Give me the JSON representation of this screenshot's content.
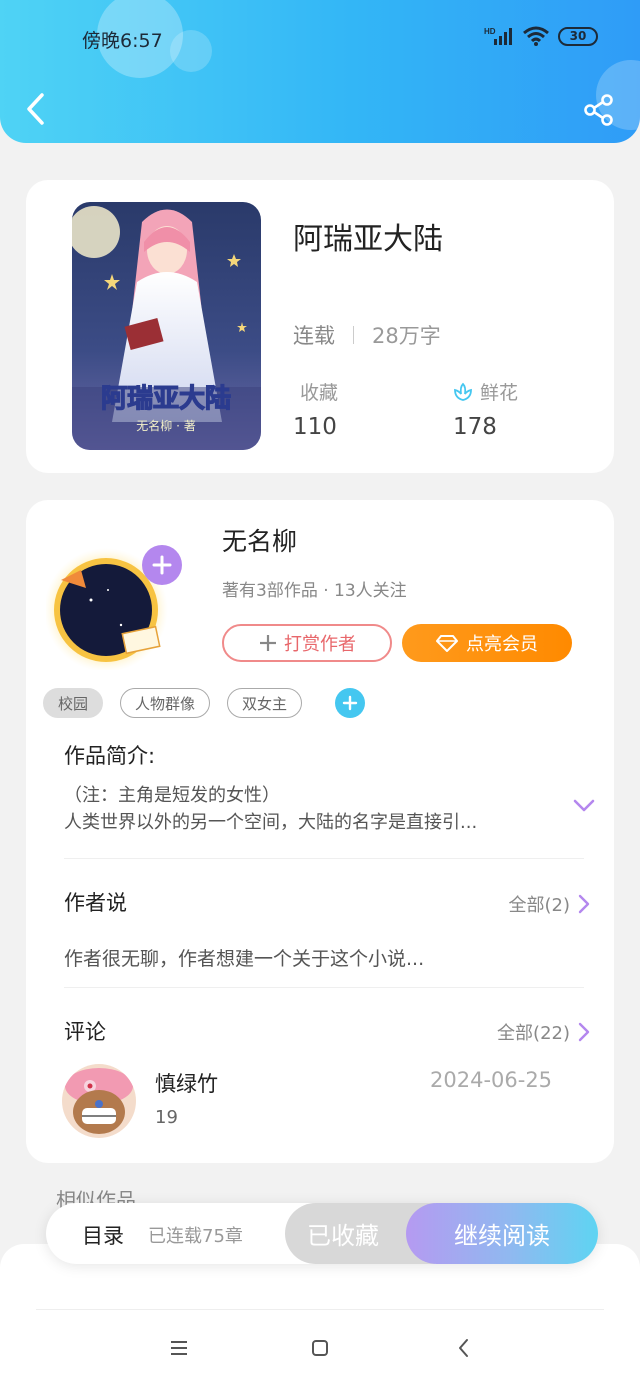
{
  "status_bar": {
    "time": "傍晚6:57",
    "battery": "30"
  },
  "book": {
    "title": "阿瑞亚大陆",
    "status": "连载",
    "word_count": "28万字",
    "favorites_label": "收藏",
    "favorites_value": "110",
    "flowers_label": "鲜花",
    "flowers_value": "178",
    "cover_title": "阿瑞亚大陆",
    "cover_author": "无名柳 · 著"
  },
  "author": {
    "name": "无名柳",
    "meta": "著有3部作品 · 13人关注",
    "tip_label": "打赏作者",
    "vip_label": "点亮会员"
  },
  "tags": [
    "校园",
    "人物群像",
    "双女主"
  ],
  "intro": {
    "title": "作品简介:",
    "line1": "（注：主角是短发的女性）",
    "line2": "人类世界以外的另一个空间，大陆的名字是直接引..."
  },
  "author_says": {
    "title": "作者说",
    "see_all": "全部(2)",
    "text": "作者很无聊，作者想建一个关于这个小说..."
  },
  "comments": {
    "title": "评论",
    "see_all": "全部(22)",
    "items": [
      {
        "user": "慎绿竹",
        "date": "2024-06-25",
        "likes": "19"
      }
    ]
  },
  "similar_title": "相似作品",
  "bottom_bar": {
    "toc_label": "目录",
    "chapters": "已连载75章",
    "collected_label": "已收藏",
    "continue_label": "继续阅读"
  },
  "colors": {
    "header_start": "#4fd3f5",
    "header_end": "#2f9cf7",
    "vip_orange": "#ff8a00",
    "tip_red": "#e8676b",
    "accent_purple": "#b59af1",
    "tag_add_blue": "#45c7f0"
  }
}
